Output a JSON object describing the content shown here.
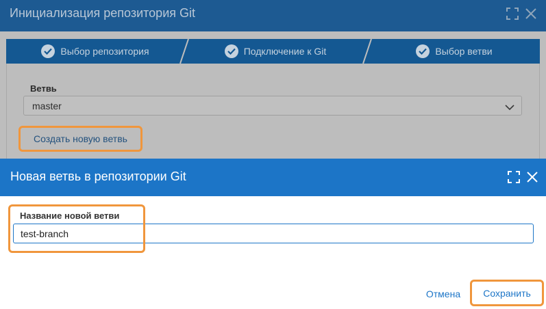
{
  "background_dialog": {
    "title": "Инициализация репозитория Git",
    "steps": [
      {
        "label": "Выбор репозитория",
        "icon": "check-circle-icon"
      },
      {
        "label": "Подключение к Git",
        "icon": "check-circle-icon"
      },
      {
        "label": "Выбор ветви",
        "icon": "check-circle-icon"
      }
    ],
    "branch_label": "Ветвь",
    "branch_value": "master",
    "create_branch_label": "Создать новую ветвь"
  },
  "dialog": {
    "title": "Новая ветвь в репозитории Git",
    "name_label": "Название новой ветви",
    "name_value": "test-branch",
    "cancel_label": "Отмена",
    "save_label": "Сохранить"
  },
  "colors": {
    "bg_title_bar": "#1d5a92",
    "fg_title_bar": "#1c75c7",
    "highlight": "#f0963c",
    "link": "#1c75c7"
  }
}
